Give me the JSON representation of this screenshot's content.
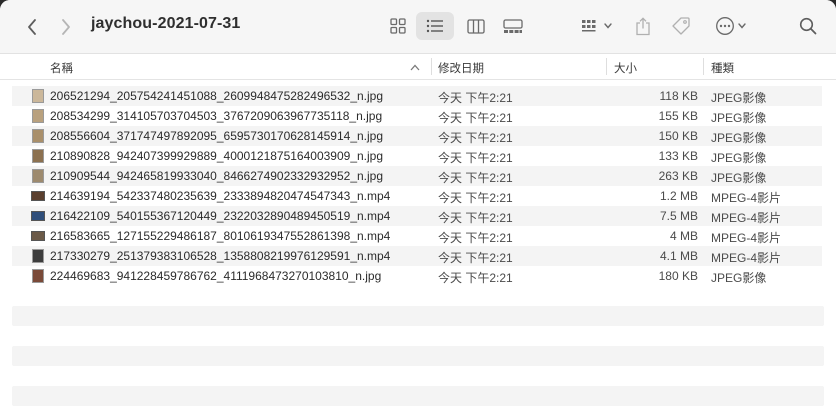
{
  "window": {
    "title": "jaychou-2021-07-31"
  },
  "toolbar": {
    "back_icon": "chevron-left-icon",
    "forward_icon": "chevron-right-icon",
    "views": [
      "icon-view",
      "list-view",
      "column-view",
      "gallery-view"
    ],
    "active_view": "list-view",
    "group_icon": "group-by-icon",
    "share_icon": "share-icon",
    "tag_icon": "tag-icon",
    "more_icon": "more-icon",
    "search_icon": "search-icon"
  },
  "columns": {
    "name": "名稱",
    "date": "修改日期",
    "size": "大小",
    "kind": "種類"
  },
  "files": [
    {
      "name": "206521294_205754241451088_2609948475282496532_n.jpg",
      "date": "今天 下午2:21",
      "size": "118 KB",
      "kind": "JPEG影像",
      "type": "image"
    },
    {
      "name": "208534299_314105703704503_3767209063967735118_n.jpg",
      "date": "今天 下午2:21",
      "size": "155 KB",
      "kind": "JPEG影像",
      "type": "image"
    },
    {
      "name": "208556604_371747497892095_6595730170628145914_n.jpg",
      "date": "今天 下午2:21",
      "size": "150 KB",
      "kind": "JPEG影像",
      "type": "image"
    },
    {
      "name": "210890828_942407399929889_4000121875164003909_n.jpg",
      "date": "今天 下午2:21",
      "size": "133 KB",
      "kind": "JPEG影像",
      "type": "image"
    },
    {
      "name": "210909544_942465819933040_8466274902332932952_n.jpg",
      "date": "今天 下午2:21",
      "size": "263 KB",
      "kind": "JPEG影像",
      "type": "image"
    },
    {
      "name": "214639194_542337480235639_2333894820474547343_n.mp4",
      "date": "今天 下午2:21",
      "size": "1.2 MB",
      "kind": "MPEG-4影片",
      "type": "video"
    },
    {
      "name": "216422109_540155367120449_2322032890489450519_n.mp4",
      "date": "今天 下午2:21",
      "size": "7.5 MB",
      "kind": "MPEG-4影片",
      "type": "video"
    },
    {
      "name": "216583665_127155229486187_8010619347552861398_n.mp4",
      "date": "今天 下午2:21",
      "size": "4 MB",
      "kind": "MPEG-4影片",
      "type": "video"
    },
    {
      "name": "217330279_251379383106528_1358808219976129591_n.mp4",
      "date": "今天 下午2:21",
      "size": "4.1 MB",
      "kind": "MPEG-4影片",
      "type": "video"
    },
    {
      "name": "224469683_941228459786762_4111968473270103810_n.jpg",
      "date": "今天 下午2:21",
      "size": "180 KB",
      "kind": "JPEG影像",
      "type": "image"
    }
  ]
}
